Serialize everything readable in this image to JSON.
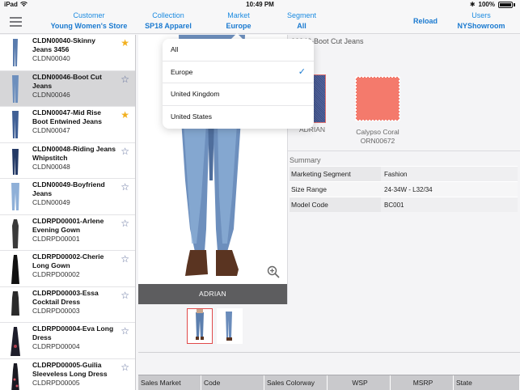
{
  "status_bar": {
    "carrier": "iPad",
    "time": "10:49 PM",
    "battery": "100%"
  },
  "nav": {
    "customer": {
      "label": "Customer",
      "value": "Young Women's Store"
    },
    "collection": {
      "label": "Collection",
      "value": "SP18 Apparel"
    },
    "market": {
      "label": "Market",
      "value": "Europe"
    },
    "segment": {
      "label": "Segment",
      "value": "All"
    },
    "reload": "Reload",
    "users": {
      "label": "Users",
      "value": "NYShowroom"
    }
  },
  "products": [
    {
      "name": "CLDN00040-Skinny Jeans 3456",
      "code": "CLDN00040",
      "starred": true
    },
    {
      "name": "CLDN00046-Boot Cut Jeans",
      "code": "CLDN00046",
      "starred": false,
      "selected": true
    },
    {
      "name": "CLDN00047-Mid Rise Boot Entwined Jeans",
      "code": "CLDN00047",
      "starred": true
    },
    {
      "name": "CLDN00048-Riding Jeans Whipstitch",
      "code": "CLDN00048",
      "starred": false
    },
    {
      "name": "CLDN00049-Boyfriend Jeans",
      "code": "CLDN00049",
      "starred": false
    },
    {
      "name": "CLDRPD00001-Arlene Evening Gown",
      "code": "CLDRPD00001",
      "starred": false
    },
    {
      "name": "CLDRPD00002-Cherie Long Gown",
      "code": "CLDRPD00002",
      "starred": false
    },
    {
      "name": "CLDRPD00003-Essa Cocktail Dress",
      "code": "CLDRPD00003",
      "starred": false
    },
    {
      "name": "CLDRPD00004-Eva Long Dress",
      "code": "CLDRPD00004",
      "starred": false
    },
    {
      "name": "CLDRPD00005-Guilia Sleeveless Long Dress",
      "code": "CLDRPD00005",
      "starred": false
    }
  ],
  "detail": {
    "title": "00046-Boot Cut Jeans",
    "code": "0046",
    "image_caption": "ADRIAN",
    "colors": [
      {
        "name": "ADRIAN",
        "code": "",
        "hex": "#4a5a92"
      },
      {
        "name": "Calypso Coral",
        "code": "ORN00672",
        "hex": "#f47a6c"
      }
    ],
    "summary_title": "Summary",
    "summary": [
      {
        "key": "Marketing Segment",
        "value": "Fashion"
      },
      {
        "key": "Size Range",
        "value": "24-34W - L32/34"
      },
      {
        "key": "Model Code",
        "value": "BC001"
      }
    ],
    "table_headers": [
      "Sales Market",
      "Code",
      "Sales Colorway",
      "WSP",
      "MSRP",
      "State"
    ]
  },
  "market_popover": {
    "options": [
      "All",
      "Europe",
      "United Kingdom",
      "United States"
    ],
    "selected": "Europe"
  },
  "colors": {
    "accent": "#1a7ad0",
    "star_on": "#f2b01e",
    "star_off": "#5b6a98",
    "caption_bg": "#5d5d5f"
  }
}
